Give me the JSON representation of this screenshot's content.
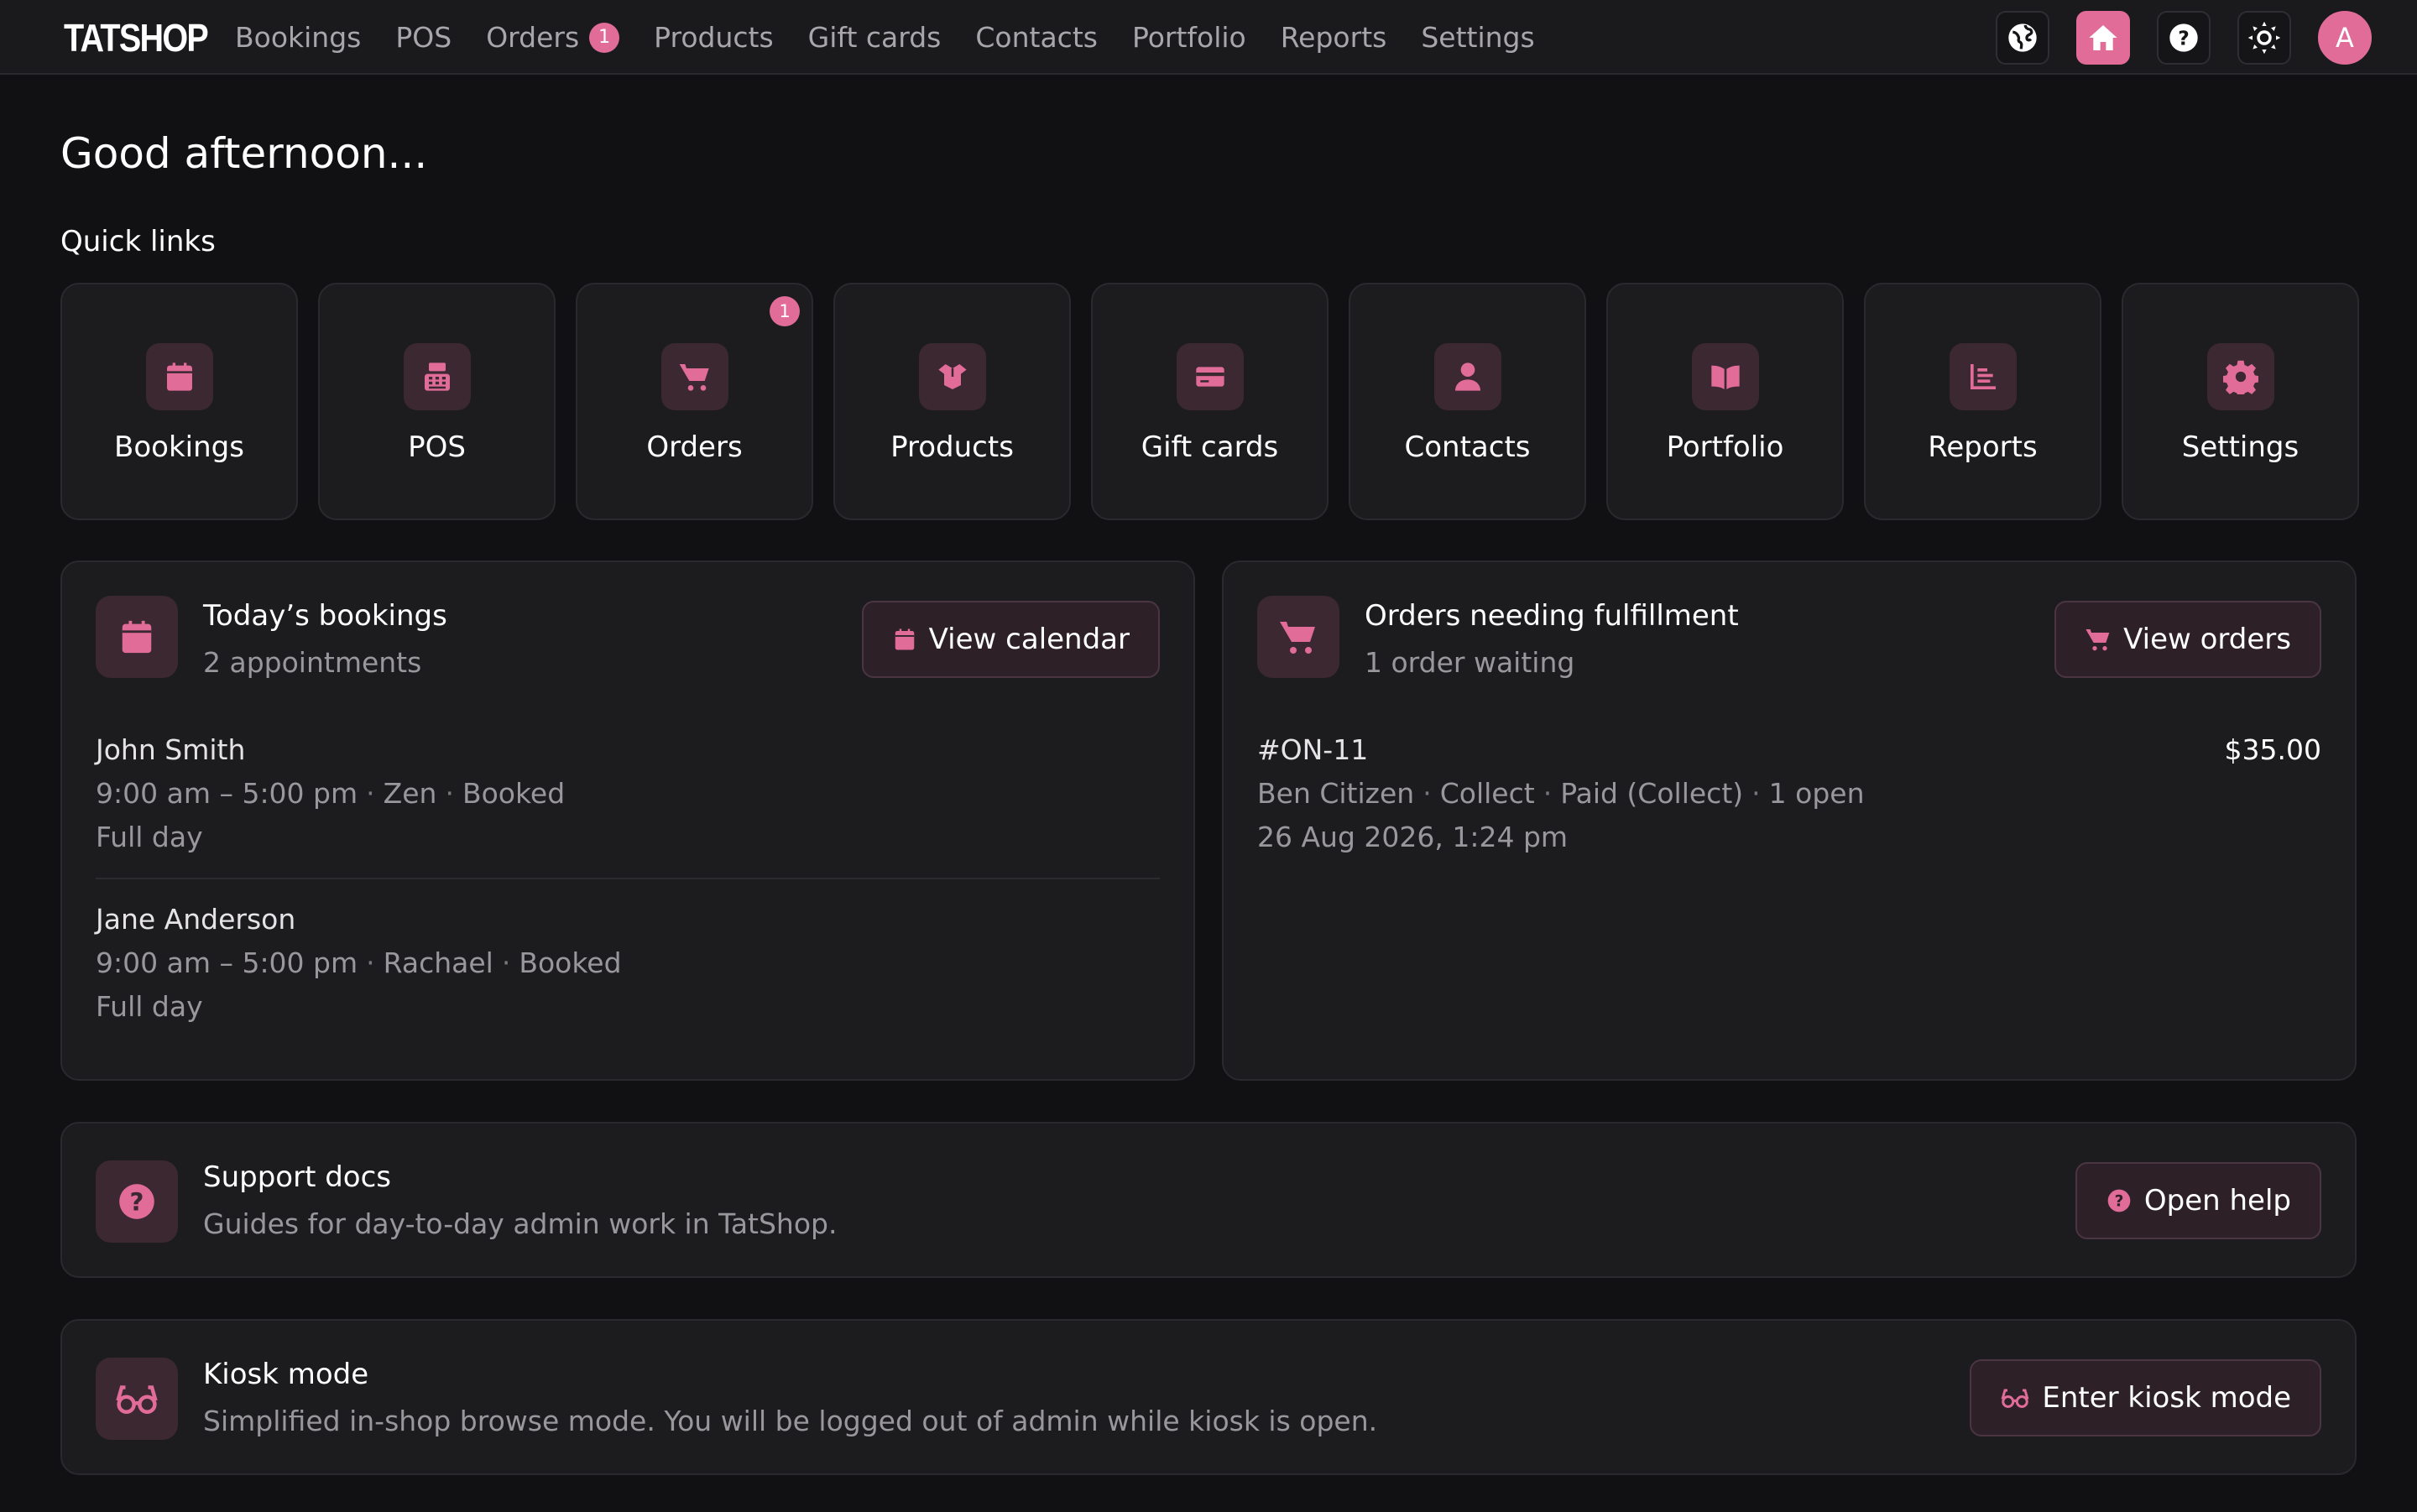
{
  "brand": "TATSHOP",
  "nav": [
    {
      "label": "Bookings"
    },
    {
      "label": "POS"
    },
    {
      "label": "Orders",
      "badge": "1"
    },
    {
      "label": "Products"
    },
    {
      "label": "Gift cards"
    },
    {
      "label": "Contacts"
    },
    {
      "label": "Portfolio"
    },
    {
      "label": "Reports"
    },
    {
      "label": "Settings"
    }
  ],
  "top_actions": {
    "globe": "globe-icon",
    "home": "home-icon",
    "help": "help-icon",
    "theme": "theme-icon",
    "avatar_initial": "A"
  },
  "greeting": "Good afternoon...",
  "quick_links": {
    "title": "Quick links",
    "items": [
      {
        "label": "Bookings",
        "icon": "calendar-icon"
      },
      {
        "label": "POS",
        "icon": "cash-register-icon"
      },
      {
        "label": "Orders",
        "icon": "cart-icon",
        "badge": "1"
      },
      {
        "label": "Products",
        "icon": "box-icon"
      },
      {
        "label": "Gift cards",
        "icon": "credit-card-icon"
      },
      {
        "label": "Contacts",
        "icon": "user-icon"
      },
      {
        "label": "Portfolio",
        "icon": "book-icon"
      },
      {
        "label": "Reports",
        "icon": "chart-icon"
      },
      {
        "label": "Settings",
        "icon": "gear-icon"
      }
    ]
  },
  "bookings": {
    "title": "Today’s bookings",
    "subtitle": "2 appointments",
    "button": "View calendar",
    "entries": [
      {
        "name": "John Smith",
        "time": "9:00 am – 5:00 pm",
        "staff": "Zen",
        "status": "Booked",
        "note": "Full day"
      },
      {
        "name": "Jane Anderson",
        "time": "9:00 am – 5:00 pm",
        "staff": "Rachael",
        "status": "Booked",
        "note": "Full day"
      }
    ]
  },
  "orders": {
    "title": "Orders needing fulfillment",
    "subtitle": "1 order waiting",
    "button": "View orders",
    "entries": [
      {
        "id": "#ON-11",
        "price": "$35.00",
        "customer": "Ben Citizen",
        "method": "Collect",
        "payment": "Paid (Collect)",
        "open": "1 open",
        "date": "26 Aug 2026, 1:24 pm"
      }
    ]
  },
  "support": {
    "title": "Support docs",
    "subtitle": "Guides for day-to-day admin work in TatShop.",
    "button": "Open help"
  },
  "kiosk": {
    "title": "Kiosk mode",
    "subtitle": "Simplified in-shop browse mode. You will be logged out of admin while kiosk is open.",
    "button": "Enter kiosk mode"
  },
  "colors": {
    "accent": "#e06c97",
    "background": "#111113",
    "card": "#1c1c1f",
    "muted_text": "#9a979c"
  }
}
